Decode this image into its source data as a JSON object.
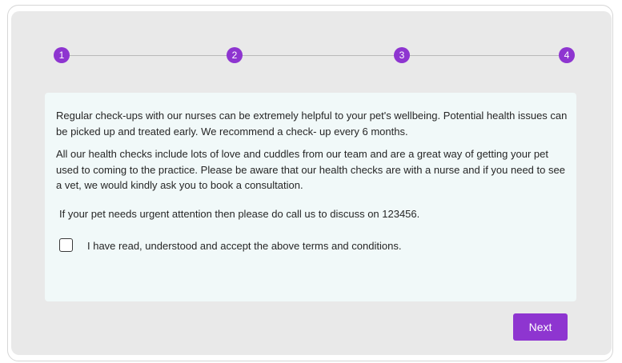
{
  "stepper": {
    "steps": [
      {
        "label": "1"
      },
      {
        "label": "2"
      },
      {
        "label": "3"
      },
      {
        "label": "4"
      }
    ]
  },
  "content": {
    "paragraph_1": "Regular check-ups with our nurses can be extremely helpful to your pet's wellbeing. Potential health issues can be picked up and treated early. We recommend a check-  up every 6 months.",
    "paragraph_2": "All our health checks include lots of love and cuddles from our team and are a great way of getting your pet used to coming to the practice. Please be aware that our  health checks are with a nurse and if you need to see a vet, we would kindly ask you to book a consultation.",
    "paragraph_3": "If your pet needs urgent attention then please do call us to discuss on 123456.",
    "terms_checkbox": {
      "label": "I have read, understood and accept the above terms and conditions.",
      "checked": false
    }
  },
  "footer": {
    "next_label": "Next"
  },
  "colors": {
    "accent": "#8e35d0",
    "panel_bg": "#e9e9e9",
    "content_bg": "#f1f9f9"
  }
}
